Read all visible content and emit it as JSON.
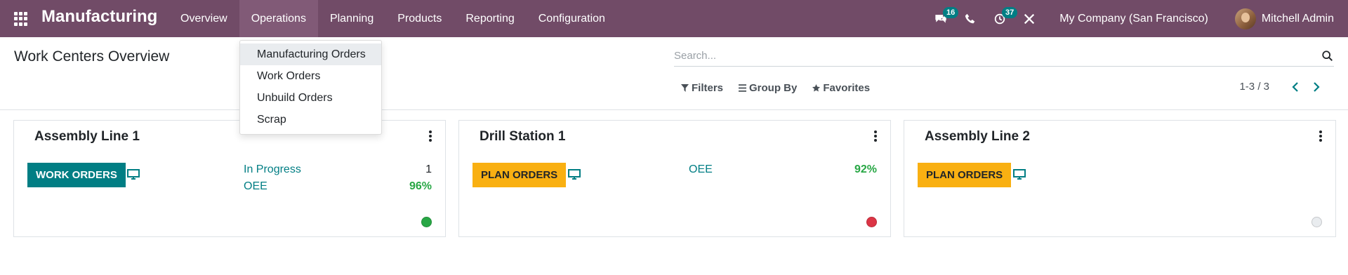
{
  "navbar": {
    "app_name": "Manufacturing",
    "menu": [
      {
        "label": "Overview"
      },
      {
        "label": "Operations"
      },
      {
        "label": "Planning"
      },
      {
        "label": "Products"
      },
      {
        "label": "Reporting"
      },
      {
        "label": "Configuration"
      }
    ],
    "messages_count": "16",
    "activities_count": "37",
    "company": "My Company (San Francisco)",
    "user": "Mitchell Admin",
    "brand_color": "#714b67",
    "badge_color": "#017e84"
  },
  "operations_menu": {
    "items": [
      {
        "label": "Manufacturing Orders"
      },
      {
        "label": "Work Orders"
      },
      {
        "label": "Unbuild Orders"
      },
      {
        "label": "Scrap"
      }
    ]
  },
  "control_panel": {
    "title": "Work Centers Overview",
    "search_placeholder": "Search...",
    "filters_label": "Filters",
    "group_by_label": "Group By",
    "favorites_label": "Favorites",
    "pager_value": "1-3 / 3"
  },
  "cards": [
    {
      "name": "Assembly Line 1",
      "button_label": "WORK ORDERS",
      "button_color": "#017e84",
      "in_progress_label": "In Progress",
      "in_progress_value": "1",
      "oee_label": "OEE",
      "oee_value": "96%",
      "status_color": "#28a745"
    },
    {
      "name": "Drill Station 1",
      "button_label": "PLAN ORDERS",
      "button_color": "#f9b012",
      "oee_label": "OEE",
      "oee_value": "92%",
      "status_color": "#dc3545"
    },
    {
      "name": "Assembly Line 2",
      "button_label": "PLAN ORDERS",
      "button_color": "#f9b012",
      "status_color": "#e9ecef"
    }
  ]
}
